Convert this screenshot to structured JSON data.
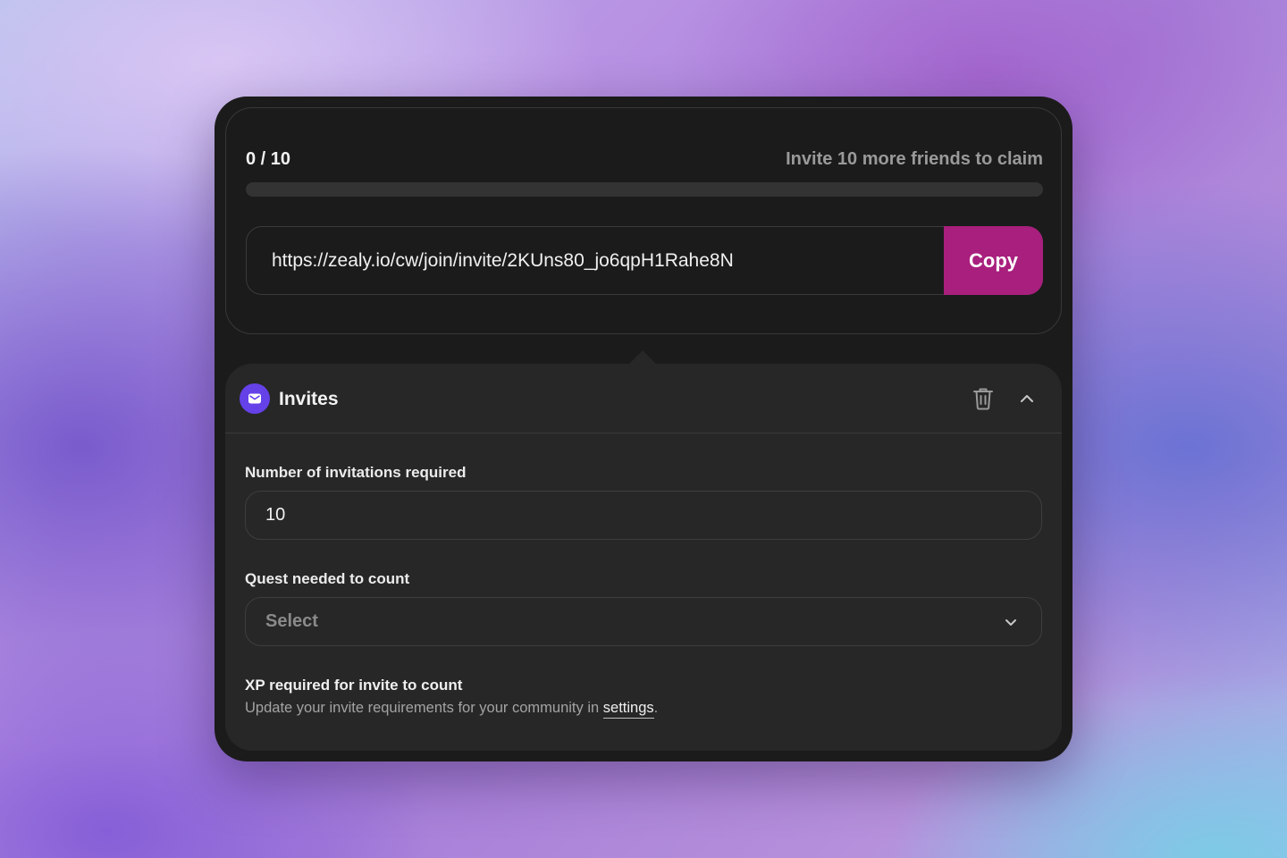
{
  "progress": {
    "count_text": "0 / 10",
    "hint": "Invite 10 more friends to claim",
    "fraction": 0
  },
  "invite_link": {
    "url": "https://zealy.io/cw/join/invite/2KUns80_jo6qpH1Rahe8N",
    "copy_label": "Copy"
  },
  "invites_panel": {
    "title": "Invites",
    "icon": "mail-icon",
    "delete_icon": "trash-icon",
    "collapse_icon": "chevron-up-icon",
    "invitations_label": "Number of invitations required",
    "invitations_value": "10",
    "quest_label": "Quest needed to count",
    "quest_placeholder": "Select",
    "xp_title": "XP required for invite to count",
    "xp_desc_prefix": "Update your invite requirements for your community in",
    "xp_link": "settings",
    "xp_desc_suffix": "."
  },
  "colors": {
    "accent": "#a81f7d",
    "badge": "#6541e8",
    "card_bg": "#1b1b1b",
    "panel_bg": "#272727"
  }
}
